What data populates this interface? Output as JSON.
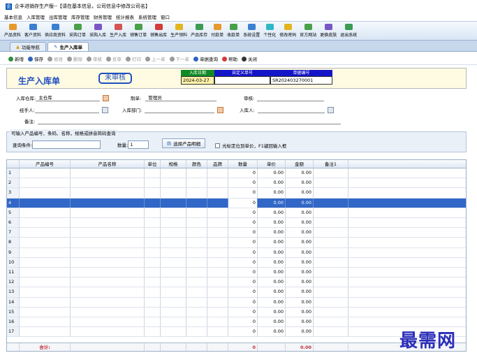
{
  "window": {
    "title": "企丰进销存生产版--【请在基本信息，公司信息中修改公司名】",
    "app_icon": "企"
  },
  "menu": [
    "基本信息",
    "入库管理",
    "出库管理",
    "库存管理",
    "财务管理",
    "统计报表",
    "系统管理",
    "窗口"
  ],
  "toolbar": [
    {
      "label": "产品资料",
      "icon": "box-icon",
      "color": "#e59a2b"
    },
    {
      "label": "客户资料",
      "icon": "people-icon",
      "color": "#3b7fd1"
    },
    {
      "label": "供应商资料",
      "icon": "supplier-icon",
      "color": "#3b7fd1"
    },
    {
      "label": "采购订单",
      "icon": "order-icon",
      "color": "#4aa04a"
    },
    {
      "label": "采购入库",
      "icon": "inbound-icon",
      "color": "#7a56c6"
    },
    {
      "label": "生产入库",
      "icon": "production-icon",
      "color": "#d45454"
    },
    {
      "label": "销售订单",
      "icon": "sales-order-icon",
      "color": "#4aa04a"
    },
    {
      "label": "销售出库",
      "icon": "sales-out-icon",
      "color": "#d43a3a"
    },
    {
      "label": "生产领料",
      "icon": "material-icon",
      "color": "#e2b420"
    },
    {
      "label": "产品库存",
      "icon": "stock-icon",
      "color": "#3b9b54"
    },
    {
      "label": "付款单",
      "icon": "payment-icon",
      "color": "#e59a2b"
    },
    {
      "label": "收款单",
      "icon": "receipt-icon",
      "color": "#4aa04a"
    },
    {
      "label": "系统设置",
      "icon": "settings-icon",
      "color": "#3b7fd1"
    },
    {
      "label": "个性化",
      "icon": "personalize-icon",
      "color": "#2fb7c8"
    },
    {
      "label": "修改密码",
      "icon": "password-icon",
      "color": "#e2b420"
    },
    {
      "label": "官方网站",
      "icon": "website-icon",
      "color": "#4aa04a"
    },
    {
      "label": "更换皮肤",
      "icon": "skin-icon",
      "color": "#7a56c6"
    },
    {
      "label": "退出系统",
      "icon": "exit-icon",
      "color": "#3b9b54"
    }
  ],
  "tabs": [
    {
      "label": "功能导航",
      "icon": "navigation-icon"
    },
    {
      "label": "生产入库单",
      "icon": "edit-icon"
    }
  ],
  "actions": [
    {
      "label": "新增",
      "icon": "add-icon",
      "color": "#2f8f3a",
      "enabled": true
    },
    {
      "label": "保存",
      "icon": "save-icon",
      "color": "#2f62c0",
      "enabled": true
    },
    {
      "label": "修改",
      "icon": "modify-icon",
      "color": "#999",
      "enabled": false
    },
    {
      "label": "删除",
      "icon": "delete-icon",
      "color": "#999",
      "enabled": false
    },
    {
      "label": "审核",
      "icon": "approve-icon",
      "color": "#999",
      "enabled": false
    },
    {
      "label": "反审",
      "icon": "unapprove-icon",
      "color": "#999",
      "enabled": false
    },
    {
      "label": "打印",
      "icon": "print-icon",
      "color": "#999",
      "enabled": false
    },
    {
      "label": "上一单",
      "icon": "prev-icon",
      "color": "#999",
      "enabled": false
    },
    {
      "label": "下一单",
      "icon": "next-icon",
      "color": "#999",
      "enabled": false
    },
    {
      "label": "单据查询",
      "icon": "query-icon",
      "color": "#2f62c0",
      "enabled": true
    },
    {
      "label": "帮助",
      "icon": "help-icon",
      "color": "#d43a3a",
      "enabled": true
    },
    {
      "label": "关闭",
      "icon": "close-icon",
      "color": "#333",
      "enabled": true
    }
  ],
  "header": {
    "title": "生产入库单",
    "status": "未审核",
    "date_label": "入库日期",
    "date_value": "2024-03-27",
    "custom_label": "自定义单号",
    "custom_value": "",
    "doc_label": "单据编号",
    "doc_value": "SR202403270001",
    "colors": {
      "green": "#0f8a25",
      "blue": "#1414c8",
      "title": "#1f4fbf"
    }
  },
  "form": {
    "warehouse_label": "入库仓库:",
    "warehouse_value": "主仓库",
    "maker_label": "制单:",
    "maker_value": "管理员",
    "reviewer_label": "审核:",
    "reviewer_value": "",
    "handler_label": "经手人:",
    "handler_value": "",
    "dept_label": "入库部门:",
    "dept_value": "",
    "receiver_label": "入库人:",
    "receiver_value": "",
    "remark_label": "备注:",
    "remark_value": ""
  },
  "query": {
    "legend": "可输入产品编号、条码、名称，规格或拼音简码查询",
    "cond_label": "查询条件:",
    "cond_value": "",
    "qty_label": "数量:",
    "qty_value": "1",
    "select_button": "选择产品明细",
    "cursor_option": "光标定位到单价，F1键回输入框"
  },
  "table": {
    "columns": [
      "",
      "产品编号",
      "产品名称",
      "单位",
      "规格",
      "颜色",
      "品牌",
      "数量",
      "单价",
      "金额",
      "备注1"
    ],
    "rows": [
      [
        "1",
        "",
        "",
        "",
        "",
        "",
        "",
        "0",
        "0.00",
        "0.00",
        ""
      ],
      [
        "2",
        "",
        "",
        "",
        "",
        "",
        "",
        "0",
        "0.00",
        "0.00",
        ""
      ],
      [
        "3",
        "",
        "",
        "",
        "",
        "",
        "",
        "0",
        "0.00",
        "0.00",
        ""
      ],
      [
        "4",
        "",
        "",
        "",
        "",
        "",
        "",
        "0",
        "0.00",
        "0.00",
        ""
      ],
      [
        "5",
        "",
        "",
        "",
        "",
        "",
        "",
        "0",
        "0.00",
        "0.00",
        ""
      ],
      [
        "6",
        "",
        "",
        "",
        "",
        "",
        "",
        "0",
        "0.00",
        "0.00",
        ""
      ],
      [
        "7",
        "",
        "",
        "",
        "",
        "",
        "",
        "0",
        "0.00",
        "0.00",
        ""
      ],
      [
        "8",
        "",
        "",
        "",
        "",
        "",
        "",
        "0",
        "0.00",
        "0.00",
        ""
      ],
      [
        "9",
        "",
        "",
        "",
        "",
        "",
        "",
        "0",
        "0.00",
        "0.00",
        ""
      ],
      [
        "10",
        "",
        "",
        "",
        "",
        "",
        "",
        "0",
        "0.00",
        "0.00",
        ""
      ],
      [
        "11",
        "",
        "",
        "",
        "",
        "",
        "",
        "0",
        "0.00",
        "0.00",
        ""
      ],
      [
        "12",
        "",
        "",
        "",
        "",
        "",
        "",
        "0",
        "0.00",
        "0.00",
        ""
      ],
      [
        "13",
        "",
        "",
        "",
        "",
        "",
        "",
        "0",
        "0.00",
        "0.00",
        ""
      ],
      [
        "14",
        "",
        "",
        "",
        "",
        "",
        "",
        "0",
        "0.00",
        "0.00",
        ""
      ],
      [
        "15",
        "",
        "",
        "",
        "",
        "",
        "",
        "0",
        "0.00",
        "0.00",
        ""
      ],
      [
        "16",
        "",
        "",
        "",
        "",
        "",
        "",
        "0",
        "0.00",
        "0.00",
        ""
      ],
      [
        "17",
        "",
        "",
        "",
        "",
        "",
        "",
        "0",
        "0.00",
        "0.00",
        ""
      ]
    ],
    "selected_row": 3,
    "footer": [
      "",
      "合计:",
      "",
      "",
      "",
      "",
      "",
      "0",
      "",
      "0.00",
      ""
    ]
  },
  "watermark": "最需网"
}
